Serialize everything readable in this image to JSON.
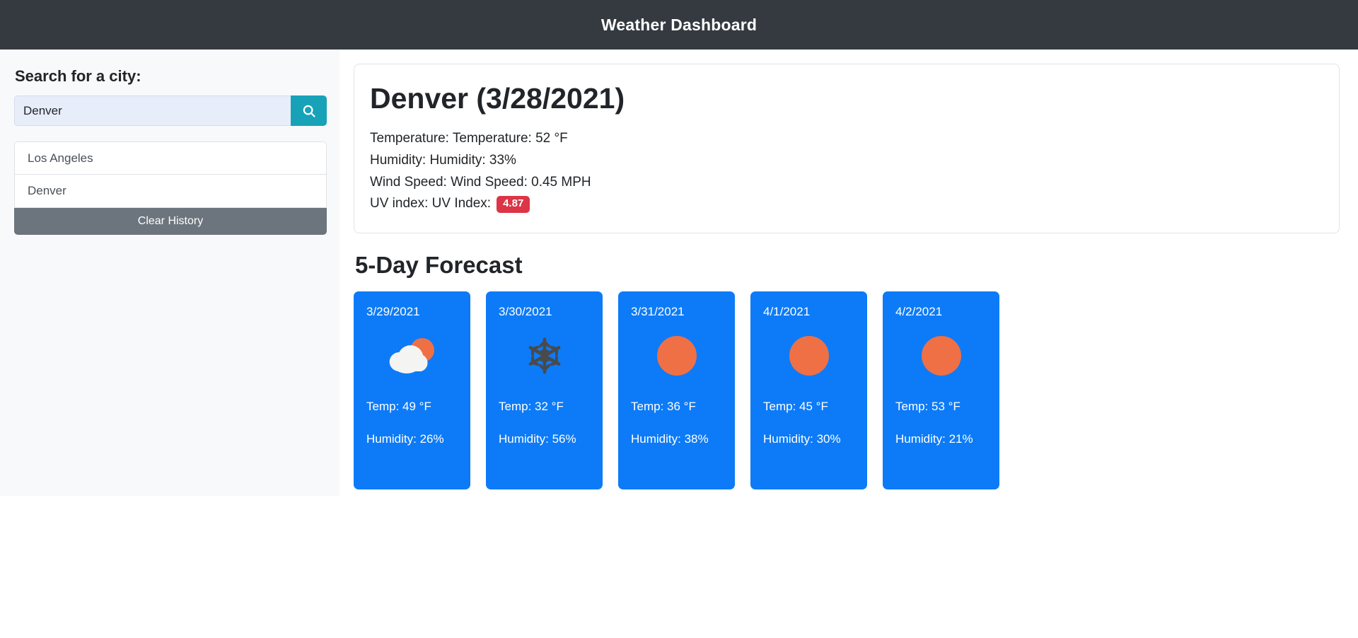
{
  "header": {
    "title": "Weather Dashboard"
  },
  "sidebar": {
    "search_label": "Search for a city:",
    "search_value": "Denver",
    "search_placeholder": "",
    "search_button_icon": "search-icon",
    "history": [
      {
        "label": "Los Angeles"
      },
      {
        "label": "Denver"
      }
    ],
    "clear_history_label": "Clear History"
  },
  "current": {
    "heading": "Denver (3/28/2021)",
    "temperature": "Temperature: Temperature: 52 °F",
    "humidity": "Humidity: Humidity: 33%",
    "wind_speed": "Wind Speed: Wind Speed: 0.45 MPH",
    "uv_label": "UV index: UV Index:",
    "uv_value": "4.87",
    "uv_badge_color": "#dc3545"
  },
  "forecast": {
    "title": "5-Day Forecast",
    "cards": [
      {
        "date": "3/29/2021",
        "icon": "partly-cloudy-icon",
        "temp": "Temp: 49 °F",
        "humidity": "Humidity: 26%"
      },
      {
        "date": "3/30/2021",
        "icon": "snowflake-icon",
        "temp": "Temp: 32 °F",
        "humidity": "Humidity: 56%"
      },
      {
        "date": "3/31/2021",
        "icon": "sun-icon",
        "temp": "Temp: 36 °F",
        "humidity": "Humidity: 38%"
      },
      {
        "date": "4/1/2021",
        "icon": "sun-icon",
        "temp": "Temp: 45 °F",
        "humidity": "Humidity: 30%"
      },
      {
        "date": "4/2/2021",
        "icon": "sun-icon",
        "temp": "Temp: 53 °F",
        "humidity": "Humidity: 21%"
      }
    ]
  },
  "colors": {
    "header_bg": "#343a40",
    "accent_teal": "#17a2b8",
    "card_blue": "#0d7bf7",
    "sun_orange": "#ef7045",
    "gray_button": "#6c757d",
    "sidebar_bg": "#f8f9fa"
  }
}
